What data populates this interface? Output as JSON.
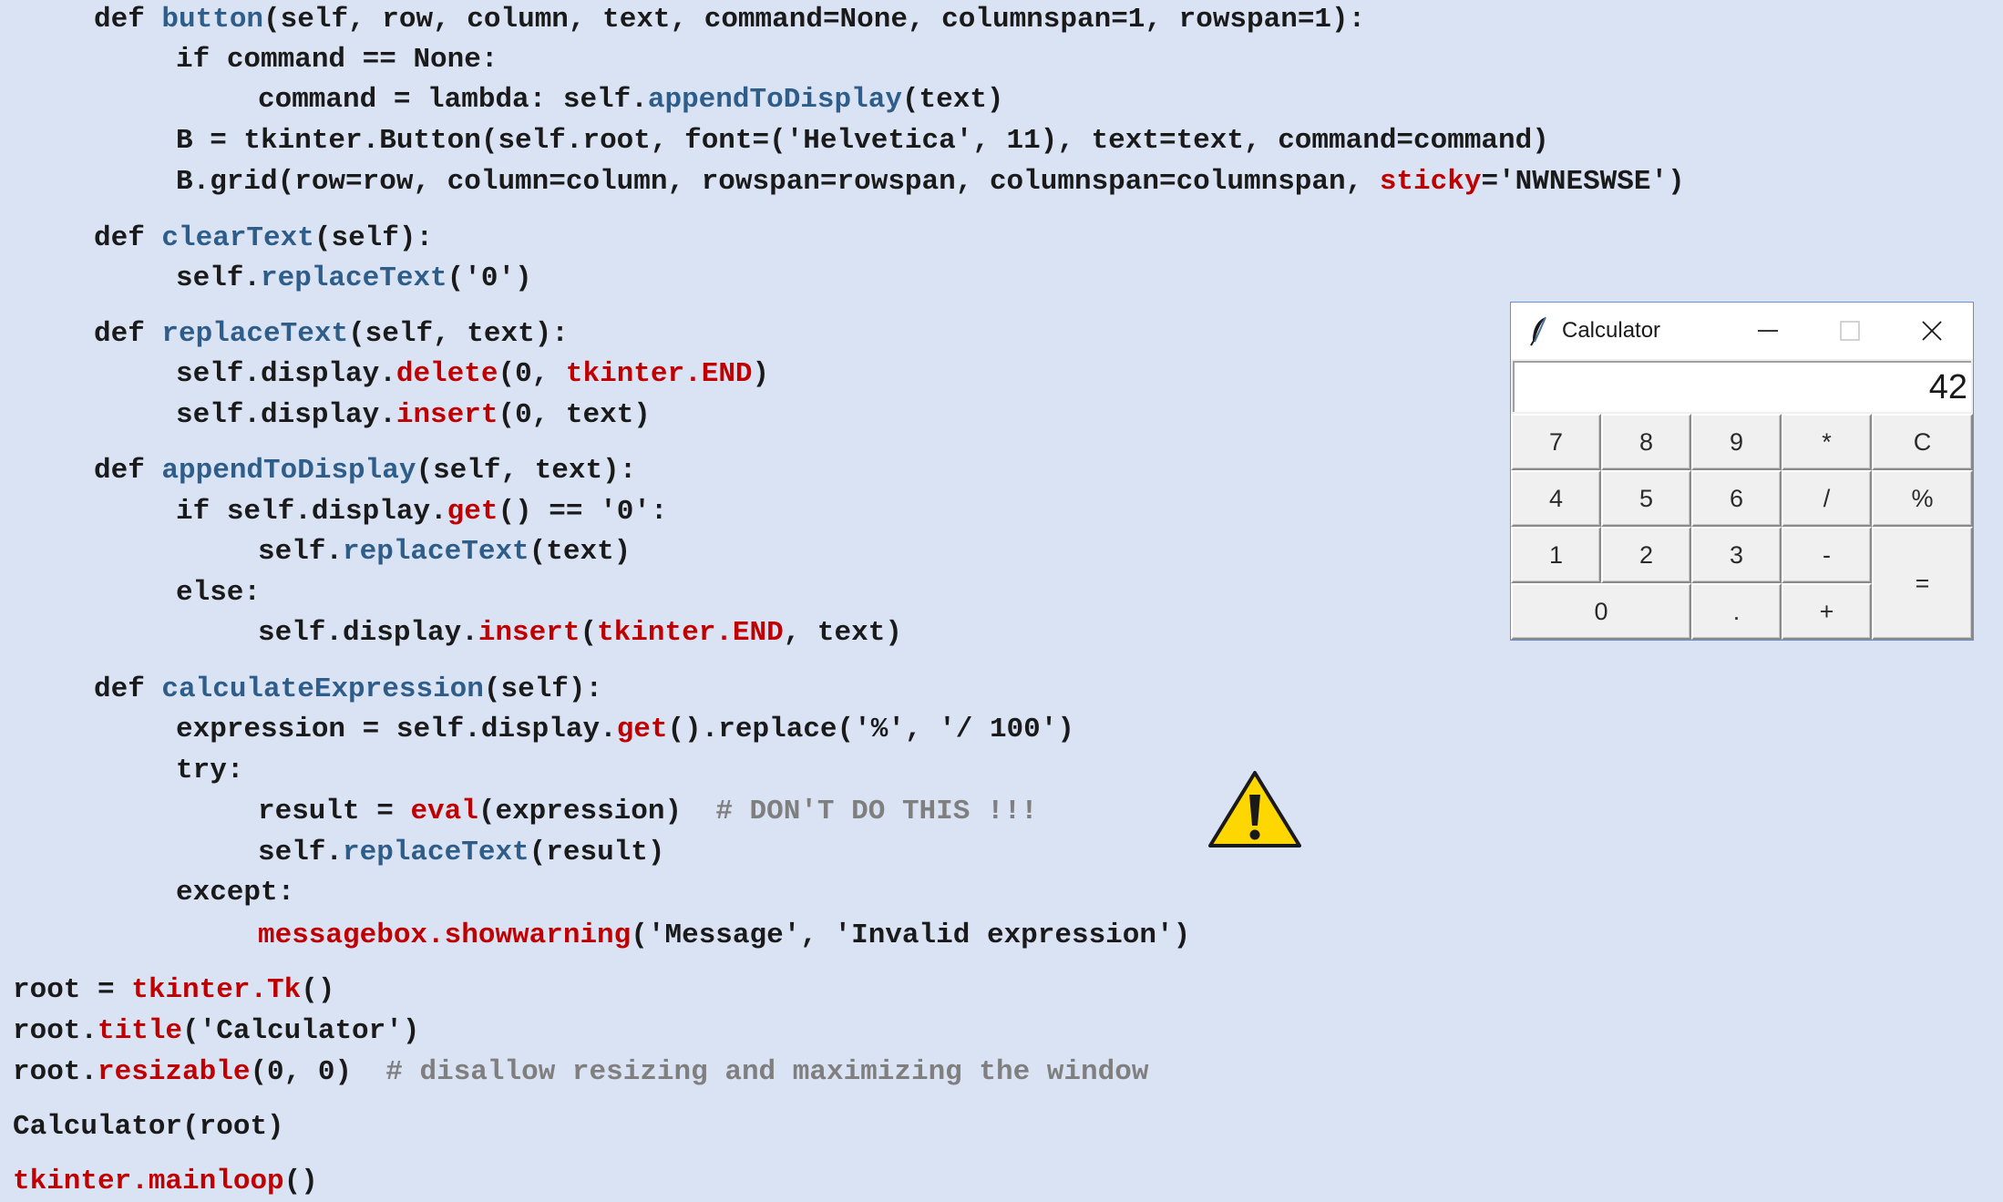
{
  "code": [
    {
      "tokens": [
        [
          "kw",
          "def "
        ],
        [
          "def",
          "button"
        ],
        [
          "plain",
          "(self, row, column, text, command=None, columnspan=1, rowspan=1):"
        ]
      ]
    },
    {
      "tokens": [
        [
          "kw",
          "if "
        ],
        [
          "plain",
          "command == None:"
        ]
      ]
    },
    {
      "tokens": [
        [
          "plain",
          "command = lambda: self."
        ],
        [
          "def",
          "appendToDisplay"
        ],
        [
          "plain",
          "(text)"
        ]
      ]
    },
    {
      "tokens": [
        [
          "plain",
          "B = tkinter.Button(self.root, font=('Helvetica', 11), text=text, command=command)"
        ]
      ]
    },
    {
      "tokens": [
        [
          "plain",
          "B.grid(row=row, column=column, rowspan=rowspan, columnspan=columnspan, "
        ],
        [
          "red",
          "sticky"
        ],
        [
          "plain",
          "='NWNESWSE')"
        ]
      ]
    },
    {
      "tokens": [
        [
          "kw",
          "def "
        ],
        [
          "def",
          "clearText"
        ],
        [
          "plain",
          "(self):"
        ]
      ]
    },
    {
      "tokens": [
        [
          "plain",
          "self."
        ],
        [
          "def",
          "replaceText"
        ],
        [
          "plain",
          "('0')"
        ]
      ]
    },
    {
      "tokens": [
        [
          "kw",
          "def "
        ],
        [
          "def",
          "replaceText"
        ],
        [
          "plain",
          "(self, text):"
        ]
      ]
    },
    {
      "tokens": [
        [
          "plain",
          "self.display."
        ],
        [
          "red",
          "delete"
        ],
        [
          "plain",
          "(0, "
        ],
        [
          "red",
          "tkinter.END"
        ],
        [
          "plain",
          ")"
        ]
      ]
    },
    {
      "tokens": [
        [
          "plain",
          "self.display."
        ],
        [
          "red",
          "insert"
        ],
        [
          "plain",
          "(0, text)"
        ]
      ]
    },
    {
      "tokens": [
        [
          "kw",
          "def "
        ],
        [
          "def",
          "appendToDisplay"
        ],
        [
          "plain",
          "(self, text):"
        ]
      ]
    },
    {
      "tokens": [
        [
          "kw",
          "if "
        ],
        [
          "plain",
          "self.display."
        ],
        [
          "red",
          "get"
        ],
        [
          "plain",
          "() == '0':"
        ]
      ]
    },
    {
      "tokens": [
        [
          "plain",
          "self."
        ],
        [
          "def",
          "replaceText"
        ],
        [
          "plain",
          "(text)"
        ]
      ]
    },
    {
      "tokens": [
        [
          "kw",
          "else"
        ],
        [
          "plain",
          ":"
        ]
      ]
    },
    {
      "tokens": [
        [
          "plain",
          "self.display."
        ],
        [
          "red",
          "insert"
        ],
        [
          "plain",
          "("
        ],
        [
          "red",
          "tkinter.END"
        ],
        [
          "plain",
          ", text)"
        ]
      ]
    },
    {
      "tokens": [
        [
          "kw",
          "def "
        ],
        [
          "def",
          "calculateExpression"
        ],
        [
          "plain",
          "(self):"
        ]
      ]
    },
    {
      "tokens": [
        [
          "plain",
          "expression = self.display."
        ],
        [
          "red",
          "get"
        ],
        [
          "plain",
          "().replace('%', '/ 100')"
        ]
      ]
    },
    {
      "tokens": [
        [
          "kw",
          "try"
        ],
        [
          "plain",
          ":"
        ]
      ]
    },
    {
      "tokens": [
        [
          "plain",
          "result = "
        ],
        [
          "red",
          "eval"
        ],
        [
          "plain",
          "(expression)  "
        ],
        [
          "comment",
          "# DON'T DO THIS !!!"
        ]
      ]
    },
    {
      "tokens": [
        [
          "plain",
          "self."
        ],
        [
          "def",
          "replaceText"
        ],
        [
          "plain",
          "(result)"
        ]
      ]
    },
    {
      "tokens": [
        [
          "kw",
          "except"
        ],
        [
          "plain",
          ":"
        ]
      ]
    },
    {
      "tokens": [
        [
          "red",
          "messagebox.showwarning"
        ],
        [
          "plain",
          "('Message', 'Invalid expression')"
        ]
      ]
    },
    {
      "tokens": [
        [
          "plain",
          "root = "
        ],
        [
          "red",
          "tkinter.Tk"
        ],
        [
          "plain",
          "()"
        ]
      ]
    },
    {
      "tokens": [
        [
          "plain",
          "root."
        ],
        [
          "red",
          "title"
        ],
        [
          "plain",
          "('Calculator')"
        ]
      ]
    },
    {
      "tokens": [
        [
          "plain",
          "root."
        ],
        [
          "red",
          "resizable"
        ],
        [
          "plain",
          "(0, 0)  "
        ],
        [
          "comment",
          "# disallow resizing and maximizing the window"
        ]
      ]
    },
    {
      "tokens": [
        [
          "plain",
          "Calculator(root)"
        ]
      ]
    },
    {
      "tokens": [
        [
          "red",
          "tkinter.mainloop"
        ],
        [
          "plain",
          "()"
        ]
      ]
    }
  ],
  "calculator": {
    "title": "Calculator",
    "display_value": "42",
    "icons": {
      "app": "tk-feather-icon",
      "minimize": "minimize-icon",
      "maximize": "maximize-icon",
      "close": "close-icon"
    },
    "buttons": [
      {
        "label": "7",
        "name": "calc-button-7"
      },
      {
        "label": "8",
        "name": "calc-button-8"
      },
      {
        "label": "9",
        "name": "calc-button-9"
      },
      {
        "label": "*",
        "name": "calc-button-multiply"
      },
      {
        "label": "C",
        "name": "calc-button-clear"
      },
      {
        "label": "4",
        "name": "calc-button-4"
      },
      {
        "label": "5",
        "name": "calc-button-5"
      },
      {
        "label": "6",
        "name": "calc-button-6"
      },
      {
        "label": "/",
        "name": "calc-button-divide"
      },
      {
        "label": "%",
        "name": "calc-button-percent"
      },
      {
        "label": "1",
        "name": "calc-button-1"
      },
      {
        "label": "2",
        "name": "calc-button-2"
      },
      {
        "label": "3",
        "name": "calc-button-3"
      },
      {
        "label": "-",
        "name": "calc-button-subtract"
      },
      {
        "label": "=",
        "name": "calc-button-equals"
      },
      {
        "label": "0",
        "name": "calc-button-0"
      },
      {
        "label": ".",
        "name": "calc-button-decimal"
      },
      {
        "label": "+",
        "name": "calc-button-add"
      }
    ]
  },
  "warning": {
    "icon": "warning-icon"
  },
  "colors": {
    "background": "#dae3f3",
    "text": "#1a1a1a",
    "function_name": "#2e5d8a",
    "builtin": "#c00000",
    "comment": "#7f7f7f",
    "warning_yellow": "#ffd700"
  }
}
